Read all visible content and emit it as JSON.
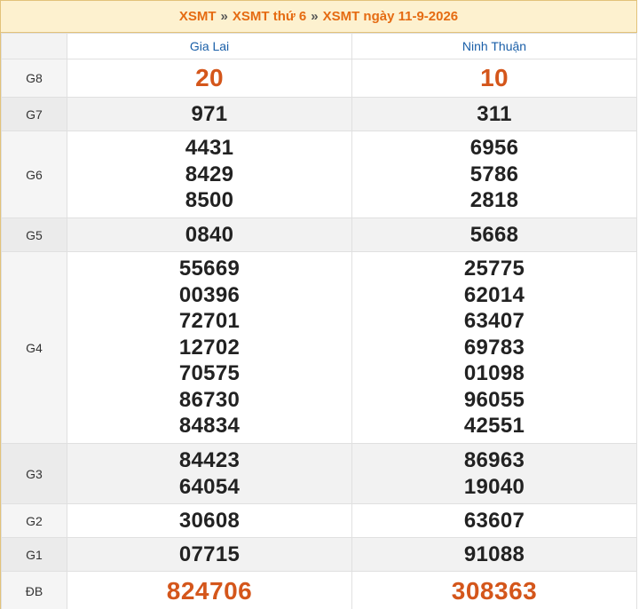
{
  "breadcrumb": {
    "items": [
      "XSMT",
      "XSMT thứ 6",
      "XSMT ngày 11-9-2026"
    ],
    "separator": "»"
  },
  "provinces": [
    "Gia Lai",
    "Ninh Thuận"
  ],
  "prizes": [
    {
      "label": "G8",
      "values": [
        [
          "20"
        ],
        [
          "10"
        ]
      ]
    },
    {
      "label": "G7",
      "values": [
        [
          "971"
        ],
        [
          "311"
        ]
      ]
    },
    {
      "label": "G6",
      "values": [
        [
          "4431",
          "8429",
          "8500"
        ],
        [
          "6956",
          "5786",
          "2818"
        ]
      ]
    },
    {
      "label": "G5",
      "values": [
        [
          "0840"
        ],
        [
          "5668"
        ]
      ]
    },
    {
      "label": "G4",
      "values": [
        [
          "55669",
          "00396",
          "72701",
          "12702",
          "70575",
          "86730",
          "84834"
        ],
        [
          "25775",
          "62014",
          "63407",
          "69783",
          "01098",
          "96055",
          "42551"
        ]
      ]
    },
    {
      "label": "G3",
      "values": [
        [
          "84423",
          "64054"
        ],
        [
          "86963",
          "19040"
        ]
      ]
    },
    {
      "label": "G2",
      "values": [
        [
          "30608"
        ],
        [
          "63607"
        ]
      ]
    },
    {
      "label": "G1",
      "values": [
        [
          "07715"
        ],
        [
          "91088"
        ]
      ]
    },
    {
      "label": "ĐB",
      "values": [
        [
          "824706"
        ],
        [
          "308363"
        ]
      ]
    }
  ],
  "colors": {
    "accent": "#e56b12",
    "highlight_number": "#d4561b",
    "province_header": "#1a5fa8",
    "breadcrumb_bg": "#fdf1cf"
  }
}
